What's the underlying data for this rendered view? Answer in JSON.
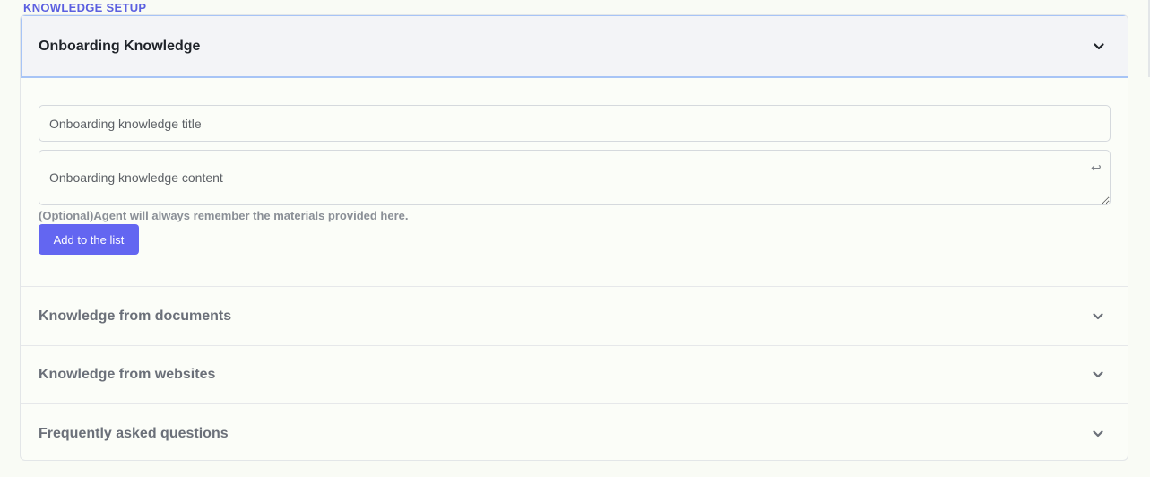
{
  "section": {
    "label": "KNOWLEDGE SETUP"
  },
  "accordion": {
    "open_item": {
      "title": "Onboarding Knowledge",
      "title_input": {
        "placeholder": "Onboarding knowledge title",
        "value": ""
      },
      "content_input": {
        "placeholder": "Onboarding knowledge content",
        "value": ""
      },
      "hint": "(Optional)Agent will always remember the materials provided here.",
      "add_button": "Add to the list",
      "enter_symbol": "↩"
    },
    "items": [
      {
        "title": "Knowledge from documents",
        "icon": "chevron-down-icon"
      },
      {
        "title": "Knowledge from websites",
        "icon": "chevron-down-icon"
      },
      {
        "title": "Frequently asked questions",
        "icon": "chevron-down-icon"
      }
    ]
  },
  "colors": {
    "accent": "#6366f1",
    "section_label": "#5b5fe0",
    "open_border": "#a7c4f6",
    "background": "#f9fbf5"
  }
}
